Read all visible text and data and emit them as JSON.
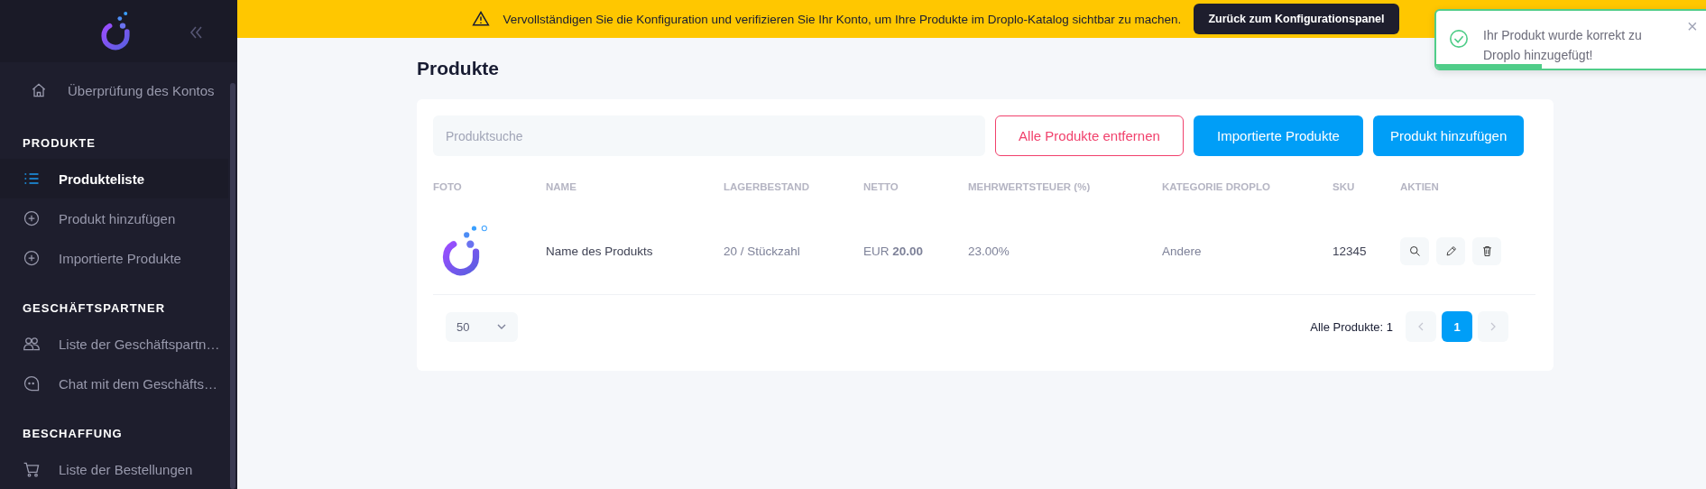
{
  "sidebar": {
    "items": [
      {
        "kind": "link",
        "label": "Überprüfung des Kontos",
        "selected": false
      },
      {
        "kind": "header",
        "label": "PRODUKTE"
      },
      {
        "kind": "link",
        "label": "Produkteliste",
        "selected": true
      },
      {
        "kind": "link",
        "label": "Produkt hinzufügen",
        "selected": false
      },
      {
        "kind": "link",
        "label": "Importierte Produkte",
        "selected": false
      },
      {
        "kind": "header",
        "label": "GESCHÄFTSPARTNER"
      },
      {
        "kind": "link",
        "label": "Liste der Geschäftspartn…",
        "selected": false
      },
      {
        "kind": "link",
        "label": "Chat mit dem Geschäfts…",
        "selected": false
      },
      {
        "kind": "header",
        "label": "BESCHAFFUNG"
      },
      {
        "kind": "link",
        "label": "Liste der Bestellungen",
        "selected": false
      }
    ]
  },
  "banner": {
    "message": "Vervollständigen Sie die Konfiguration und verifizieren Sie Ihr Konto, um Ihre Produkte im Droplo-Katalog sichtbar zu machen.",
    "button": "Zurück zum Konfigurationspanel"
  },
  "toast": {
    "message": "Ihr Produkt wurde korrekt zu Droplo hinzugefügt!",
    "close": "×",
    "level": 0.37
  },
  "page": {
    "title": "Produkte"
  },
  "toolbar": {
    "search": {
      "placeholder": "Produktsuche"
    },
    "buttons": [
      {
        "kind": "outline",
        "label": "Alle Produkte entfernen"
      },
      {
        "kind": "primary",
        "label": "Importierte Produkte"
      },
      {
        "kind": "primary",
        "label": "Produkt hinzufügen"
      }
    ]
  },
  "table": {
    "columns": [
      "FOTO",
      "NAME",
      "LAGERBESTAND",
      "NETTO",
      "MEHRWERTSTEUER (%)",
      "KATEGORIE DROPLO",
      "SKU",
      "AKTIEN"
    ],
    "rows": [
      {
        "name": "Name des Produkts",
        "stock": "20 / Stückzahl",
        "net": "EUR **20.00**",
        "vat": "23.00%",
        "category": "Andere",
        "sku": "12345",
        "actions": [
          {
            "kind": "search"
          },
          {
            "kind": "edit"
          },
          {
            "kind": "delete"
          }
        ]
      }
    ]
  },
  "footer": {
    "page_size": "50",
    "total": "Alle Produkte: 1",
    "pages": [
      {
        "kind": "prev"
      },
      {
        "kind": "page",
        "label": "1",
        "selected": true
      },
      {
        "kind": "next"
      }
    ]
  }
}
